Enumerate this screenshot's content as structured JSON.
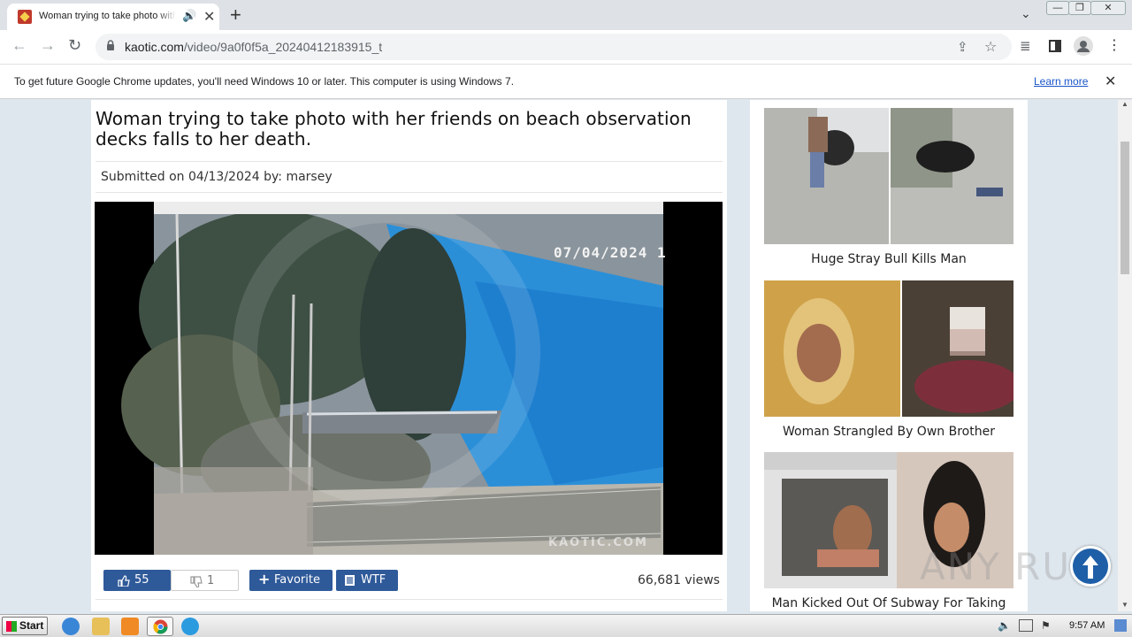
{
  "browser": {
    "tab_title": "Woman trying to take photo with her friends on beach observation decks falls to her death.",
    "url_domain": "kaotic.com",
    "url_path": "/video/9a0f0f5a_20240412183915_t",
    "new_tab_glyph": "+",
    "close_glyph": "✕",
    "speaker_glyph": "🔊",
    "tab_list_glyph": "⌄",
    "window_controls": [
      "—",
      "❐",
      "✕"
    ]
  },
  "infobar": {
    "message": "To get future Google Chrome updates, you'll need Windows 10 or later. This computer is using Windows 7.",
    "learn_more": "Learn more",
    "close_glyph": "✕"
  },
  "article": {
    "headline": "Woman trying to take photo with her friends on beach observation decks falls to her death.",
    "submitted": "Submitted on 04/13/2024 by: marsey",
    "video_timestamp": "07/04/2024 1",
    "video_watermark": "KAOTIC.COM"
  },
  "actions": {
    "likes": "55",
    "dislikes": "1",
    "favorite": "Favorite",
    "wtf": "WTF",
    "views": "66,681 views"
  },
  "sidebar": {
    "items": [
      {
        "title": "Huge Stray Bull Kills Man"
      },
      {
        "title": "Woman Strangled By Own Brother"
      },
      {
        "title": "Man Kicked Out Of Subway For Taking"
      }
    ]
  },
  "watermark": {
    "text": "ANY RUN"
  },
  "taskbar": {
    "start_label": "Start",
    "clock": "9:57 AM"
  },
  "icons": [
    "lock-icon",
    "share-icon",
    "star-icon",
    "media-icon",
    "sidepanel-icon",
    "profile-icon",
    "menu-icon",
    "thumbs-up-icon",
    "thumbs-down-icon",
    "plus-icon",
    "wtf-icon",
    "arrow-up-icon"
  ],
  "colors": {
    "accent_blue": "#2f5a9a",
    "link_blue": "#1a55c8",
    "page_bg": "#dfe7ee"
  }
}
